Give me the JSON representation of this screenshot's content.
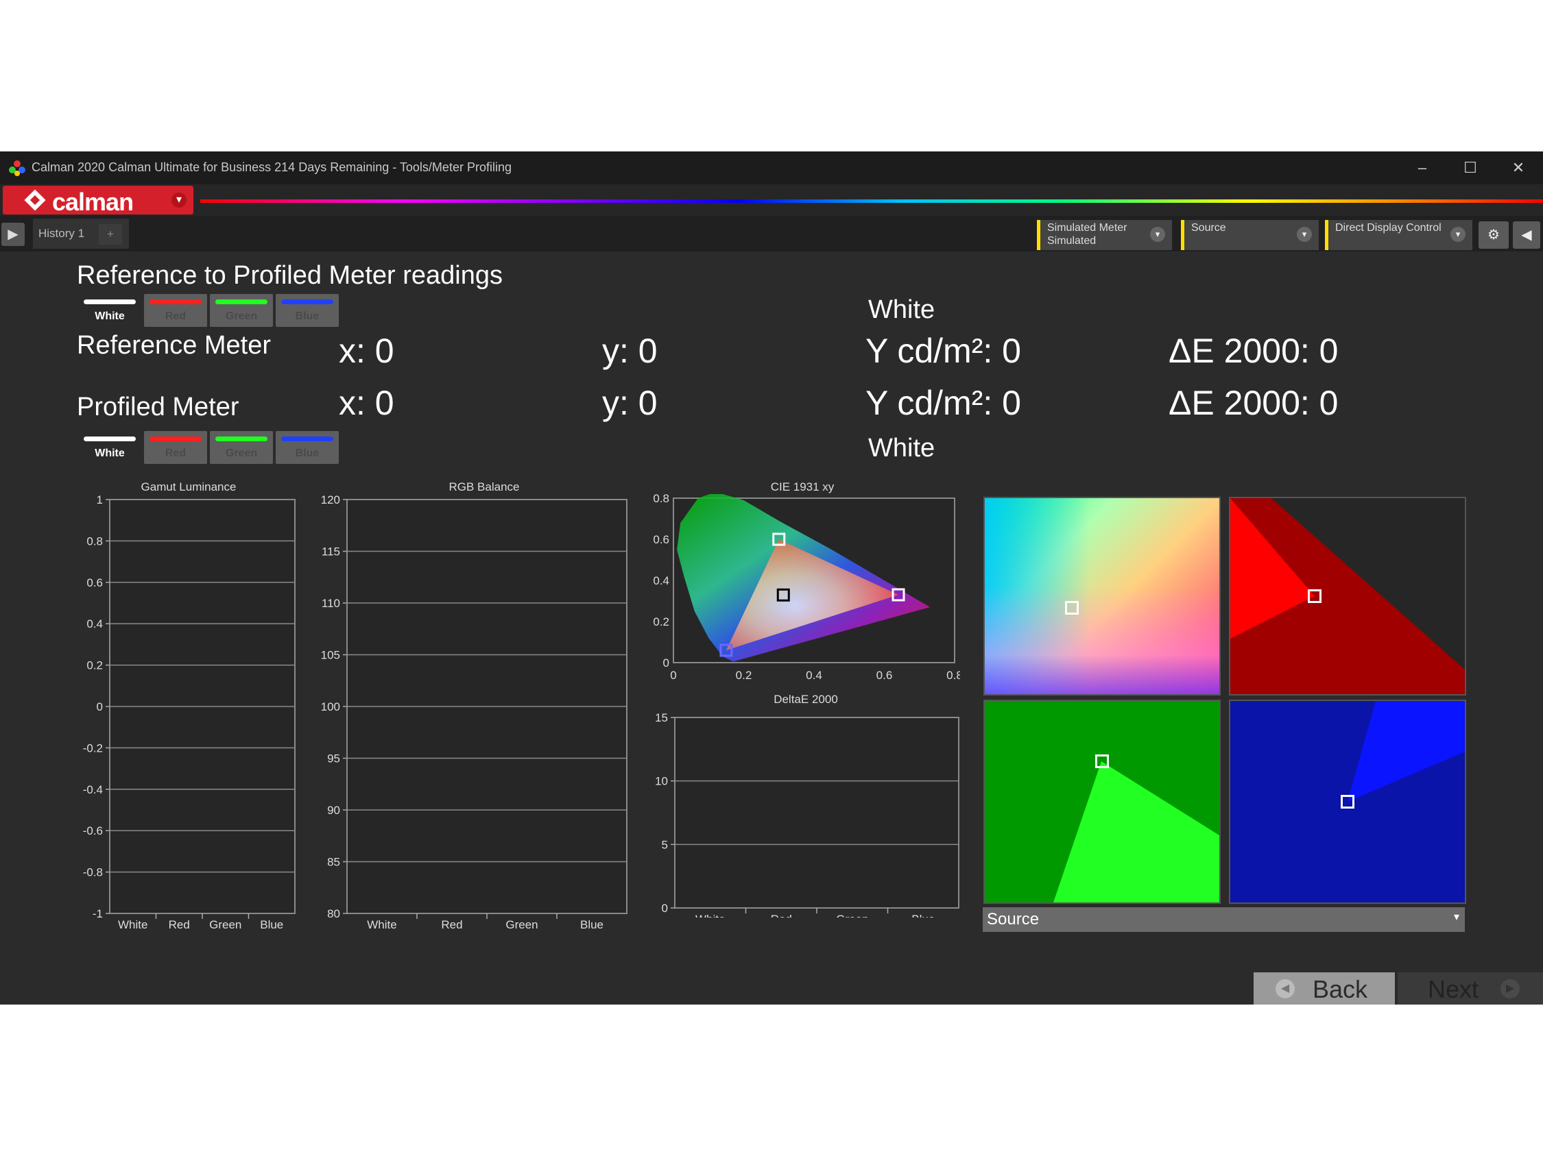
{
  "window": {
    "title": "Calman 2020 Calman Ultimate for Business 214 Days Remaining  -  Tools/Meter Profiling",
    "minimize": "–",
    "maximize": "☐",
    "close": "✕"
  },
  "brand": {
    "name": "calman",
    "dropdown": "▾"
  },
  "toolbar": {
    "play": "▶",
    "history_tab": "History 1",
    "add_tab": "+",
    "meter_dropdown": {
      "line1": "Simulated Meter",
      "line2": "Simulated"
    },
    "source_dropdown": {
      "line1": "Source",
      "line2": ""
    },
    "display_dropdown": {
      "line1": "Direct Display Control",
      "line2": ""
    },
    "dropdown_arrow": "▾",
    "settings_icon": "gear-icon",
    "settings_glyph": "⚙",
    "collapse_glyph": "◀"
  },
  "heading": "Reference to Profiled Meter readings",
  "swatches": [
    {
      "label": "White",
      "color": "#ffffff",
      "active": true
    },
    {
      "label": "Red",
      "color": "#ff2020",
      "active": false
    },
    {
      "label": "Green",
      "color": "#20ff20",
      "active": false
    },
    {
      "label": "Blue",
      "color": "#2040ff",
      "active": false
    }
  ],
  "reference": {
    "label": "Reference Meter",
    "patch": "White",
    "x": "x: 0",
    "y": "y: 0",
    "Y": "Y cd/m²: 0",
    "de": "ΔE 2000: 0"
  },
  "profiled": {
    "label": "Profiled Meter",
    "patch": "White",
    "x": "x: 0",
    "y": "y: 0",
    "Y": "Y cd/m²: 0",
    "de": "ΔE 2000: 0"
  },
  "chart_data": [
    {
      "type": "bar",
      "title": "Gamut Luminance",
      "categories": [
        "White",
        "Red",
        "Green",
        "Blue"
      ],
      "yticks": [
        "1",
        "0.8",
        "0.6",
        "0.4",
        "0.2",
        "0",
        "-0.2",
        "-0.4",
        "-0.6",
        "-0.8",
        "-1"
      ],
      "ylim": [
        -1,
        1
      ],
      "values": [
        0,
        0,
        0,
        0
      ]
    },
    {
      "type": "bar",
      "title": "RGB Balance",
      "categories": [
        "White",
        "Red",
        "Green",
        "Blue"
      ],
      "yticks": [
        "120",
        "115",
        "110",
        "105",
        "100",
        "95",
        "90",
        "85",
        "80"
      ],
      "ylim": [
        80,
        120
      ],
      "values": []
    },
    {
      "type": "scatter",
      "title": "CIE 1931 xy",
      "xticks": [
        "0",
        "0.2",
        "0.4",
        "0.6",
        "0.8"
      ],
      "yticks": [
        "0.8",
        "0.6",
        "0.4",
        "0.2",
        "0"
      ],
      "xlim": [
        0,
        0.8
      ],
      "ylim": [
        0,
        0.8
      ],
      "points": [
        {
          "name": "Red",
          "x": 0.64,
          "y": 0.33
        },
        {
          "name": "Green",
          "x": 0.3,
          "y": 0.6
        },
        {
          "name": "Blue",
          "x": 0.15,
          "y": 0.06
        },
        {
          "name": "White",
          "x": 0.3127,
          "y": 0.329
        }
      ]
    },
    {
      "type": "bar",
      "title": "DeltaE 2000",
      "categories": [
        "White",
        "Red",
        "Green",
        "Blue"
      ],
      "yticks": [
        "15",
        "10",
        "5",
        "0"
      ],
      "ylim": [
        0,
        15
      ],
      "values": [
        0,
        0,
        0,
        0
      ]
    }
  ],
  "color_panels": {
    "white": {
      "marker": [
        0.37,
        0.56
      ]
    },
    "red": {
      "marker": [
        0.36,
        0.5
      ]
    },
    "green": {
      "marker": [
        0.5,
        0.3
      ]
    },
    "blue": {
      "marker": [
        0.5,
        0.5
      ]
    }
  },
  "source_select": {
    "value": "Source",
    "arrow": "▾"
  },
  "nav": {
    "back": "Back",
    "next": "Next",
    "back_glyph": "◀",
    "next_glyph": "▶"
  }
}
